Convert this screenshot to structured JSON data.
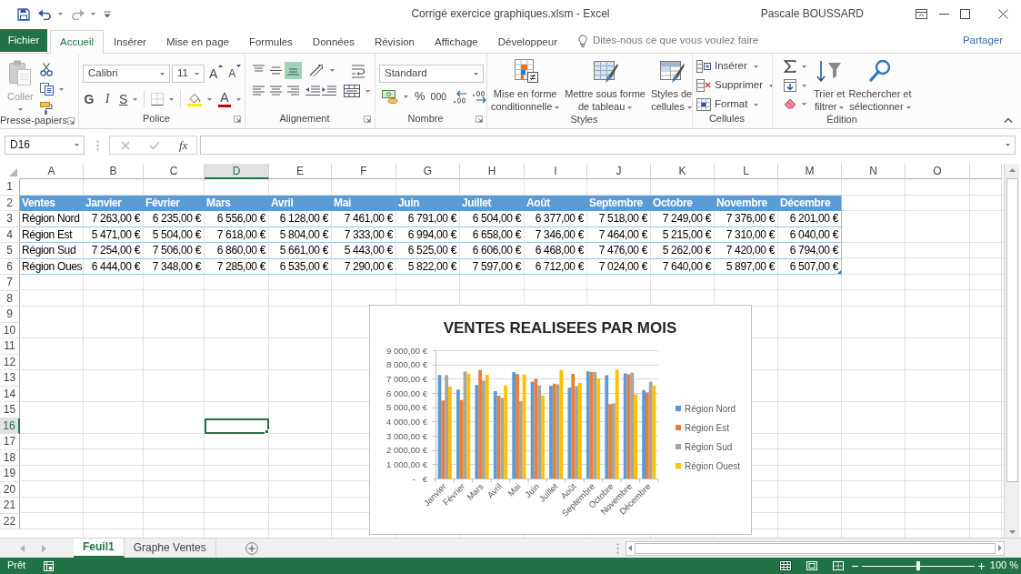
{
  "title_bar": {
    "title": "Corrigé exercice graphiques.xlsm - Excel",
    "user": "Pascale BOUSSARD"
  },
  "ribbon_tabs": [
    {
      "label": "Fichier",
      "kind": "file",
      "selected": false
    },
    {
      "label": "Accueil",
      "kind": "tab",
      "selected": true
    },
    {
      "label": "Insérer",
      "kind": "tab",
      "selected": false
    },
    {
      "label": "Mise en page",
      "kind": "tab",
      "selected": false
    },
    {
      "label": "Formules",
      "kind": "tab",
      "selected": false
    },
    {
      "label": "Données",
      "kind": "tab",
      "selected": false
    },
    {
      "label": "Révision",
      "kind": "tab",
      "selected": false
    },
    {
      "label": "Affichage",
      "kind": "tab",
      "selected": false
    },
    {
      "label": "Développeur",
      "kind": "tab",
      "selected": false
    }
  ],
  "tell_me": {
    "placeholder": "Dites-nous ce que vous voulez faire"
  },
  "share": "Partager",
  "ribbon": {
    "clipboard": {
      "label": "Presse-papiers",
      "paste": {
        "label": "Coller",
        "disabled": true
      }
    },
    "font": {
      "label": "Police",
      "font_name": "Calibri",
      "font_size": "11",
      "grow": "A",
      "shrink": "A",
      "bold": "G",
      "italic": "I",
      "underline": "S",
      "font_color": "A"
    },
    "alignment": {
      "label": "Alignement",
      "vertical": [
        {
          "selected": false
        },
        {
          "selected": false
        },
        {
          "selected": true
        }
      ]
    },
    "number": {
      "label": "Nombre",
      "format": "Standard",
      "percent": "%",
      "thousands": "000"
    },
    "styles": {
      "label": "Styles",
      "buttons": [
        {
          "lines": [
            "Mise en forme",
            "conditionnelle"
          ]
        },
        {
          "lines": [
            "Mettre sous forme",
            "de tableau"
          ]
        },
        {
          "lines": [
            "Styles de",
            "cellules"
          ]
        }
      ]
    },
    "cells": {
      "label": "Cellules",
      "buttons": [
        "Insérer",
        "Supprimer",
        "Format"
      ]
    },
    "editing": {
      "label": "Édition",
      "buttons": [
        {
          "lines": [
            "Trier et",
            "filtrer"
          ]
        },
        {
          "lines": [
            "Rechercher et",
            "sélectionner"
          ]
        }
      ]
    }
  },
  "formula_bar": {
    "name_box": "D16",
    "function_button": "fx"
  },
  "sheet": {
    "columns": [
      {
        "label": "A",
        "selected": false
      },
      {
        "label": "B",
        "selected": false
      },
      {
        "label": "C",
        "selected": false
      },
      {
        "label": "D",
        "selected": true
      },
      {
        "label": "E",
        "selected": false
      },
      {
        "label": "F",
        "selected": false
      },
      {
        "label": "G",
        "selected": false
      },
      {
        "label": "H",
        "selected": false
      },
      {
        "label": "I",
        "selected": false
      },
      {
        "label": "J",
        "selected": false
      },
      {
        "label": "K",
        "selected": false
      },
      {
        "label": "L",
        "selected": false
      },
      {
        "label": "M",
        "selected": false
      },
      {
        "label": "N",
        "selected": false
      },
      {
        "label": "O",
        "selected": false
      }
    ],
    "rows": [
      {
        "number": "1",
        "kind": "empty",
        "selected": false
      },
      {
        "number": "2",
        "kind": "table_header",
        "selected": false,
        "cells": [
          "Ventes",
          "Janvier",
          "Février",
          "Mars",
          "Avril",
          "Mai",
          "Juin",
          "Juillet",
          "Août",
          "Septembre",
          "Octobre",
          "Novembre",
          "Décembre"
        ]
      },
      {
        "number": "3",
        "kind": "table_row",
        "selected": false,
        "cells": [
          "Région Nord",
          "7 263,00 €",
          "6 235,00 €",
          "6 556,00 €",
          "6 128,00 €",
          "7 461,00 €",
          "6 791,00 €",
          "6 504,00 €",
          "6 377,00 €",
          "7 518,00 €",
          "7 249,00 €",
          "7 376,00 €",
          "6 201,00 €"
        ]
      },
      {
        "number": "4",
        "kind": "table_row",
        "selected": false,
        "cells": [
          "Région Est",
          "5 471,00 €",
          "5 504,00 €",
          "7 618,00 €",
          "5 804,00 €",
          "7 333,00 €",
          "6 994,00 €",
          "6 658,00 €",
          "7 346,00 €",
          "7 464,00 €",
          "5 215,00 €",
          "7 310,00 €",
          "6 040,00 €"
        ]
      },
      {
        "number": "5",
        "kind": "table_row",
        "selected": false,
        "cells": [
          "Région Sud",
          "7 254,00 €",
          "7 506,00 €",
          "6 860,00 €",
          "5 661,00 €",
          "5 443,00 €",
          "6 525,00 €",
          "6 606,00 €",
          "6 468,00 €",
          "7 476,00 €",
          "5 262,00 €",
          "7 420,00 €",
          "6 794,00 €"
        ]
      },
      {
        "number": "6",
        "kind": "table_row",
        "selected": false,
        "cells": [
          "Région Oues",
          "6 444,00 €",
          "7 348,00 €",
          "7 285,00 €",
          "6 535,00 €",
          "7 290,00 €",
          "5 822,00 €",
          "7 597,00 €",
          "6 712,00 €",
          "7 024,00 €",
          "7 640,00 €",
          "5 897,00 €",
          "6 507,00 €"
        ]
      },
      {
        "number": "7",
        "kind": "empty",
        "selected": false
      },
      {
        "number": "8",
        "kind": "empty",
        "selected": false
      },
      {
        "number": "9",
        "kind": "empty",
        "selected": false
      },
      {
        "number": "10",
        "kind": "empty",
        "selected": false
      },
      {
        "number": "11",
        "kind": "empty",
        "selected": false
      },
      {
        "number": "12",
        "kind": "empty",
        "selected": false
      },
      {
        "number": "13",
        "kind": "empty",
        "selected": false
      },
      {
        "number": "14",
        "kind": "empty",
        "selected": false
      },
      {
        "number": "15",
        "kind": "empty",
        "selected": false
      },
      {
        "number": "16",
        "kind": "empty",
        "selected": true
      },
      {
        "number": "17",
        "kind": "empty",
        "selected": false
      },
      {
        "number": "18",
        "kind": "empty",
        "selected": false
      },
      {
        "number": "19",
        "kind": "empty",
        "selected": false
      },
      {
        "number": "20",
        "kind": "empty",
        "selected": false
      },
      {
        "number": "21",
        "kind": "empty",
        "selected": false
      },
      {
        "number": "22",
        "kind": "empty",
        "selected": false
      }
    ]
  },
  "chart": {
    "chart_data": {
      "type": "bar",
      "title": "VENTES REALISEES PAR MOIS",
      "categories": [
        "Janvier",
        "Février",
        "Mars",
        "Avril",
        "Mai",
        "Juin",
        "Juillet",
        "Août",
        "Septembre",
        "Octobre",
        "Novembre",
        "Décembre"
      ],
      "series": [
        {
          "name": "Région Nord",
          "color": "#5b9bd5",
          "values": [
            7263,
            6235,
            6556,
            6128,
            7461,
            6791,
            6504,
            6377,
            7518,
            7249,
            7376,
            6201
          ]
        },
        {
          "name": "Région Est",
          "color": "#ed7d31",
          "values": [
            5471,
            5504,
            7618,
            5804,
            7333,
            6994,
            6658,
            7346,
            7464,
            5215,
            7310,
            6040
          ]
        },
        {
          "name": "Région Sud",
          "color": "#a5a5a5",
          "values": [
            7254,
            7506,
            6860,
            5661,
            5443,
            6525,
            6606,
            6468,
            7476,
            5262,
            7420,
            6794
          ]
        },
        {
          "name": "Région Ouest",
          "color": "#ffc000",
          "values": [
            6444,
            7348,
            7285,
            6535,
            7290,
            5822,
            7597,
            6712,
            7024,
            7640,
            5897,
            6507
          ]
        }
      ],
      "ylim": [
        0,
        9000
      ],
      "yticks": [
        {
          "value": 0,
          "label": "-   €"
        },
        {
          "value": 1000,
          "label": "1 000,00 €"
        },
        {
          "value": 2000,
          "label": "2 000,00 €"
        },
        {
          "value": 3000,
          "label": "3 000,00 €"
        },
        {
          "value": 4000,
          "label": "4 000,00 €"
        },
        {
          "value": 5000,
          "label": "5 000,00 €"
        },
        {
          "value": 6000,
          "label": "6 000,00 €"
        },
        {
          "value": 7000,
          "label": "7 000,00 €"
        },
        {
          "value": 8000,
          "label": "8 000,00 €"
        },
        {
          "value": 9000,
          "label": "9 000,00 €"
        }
      ],
      "grid": true,
      "legend": "right"
    }
  },
  "sheet_tabs": [
    {
      "label": "Feuil1",
      "selected": true
    },
    {
      "label": "Graphe Ventes",
      "selected": false
    }
  ],
  "status_bar": {
    "status": "Prêt",
    "views": [
      {
        "selected": true
      },
      {
        "selected": false
      },
      {
        "selected": false
      }
    ],
    "zoom": {
      "level": 0.5,
      "reading": "100 %"
    }
  }
}
